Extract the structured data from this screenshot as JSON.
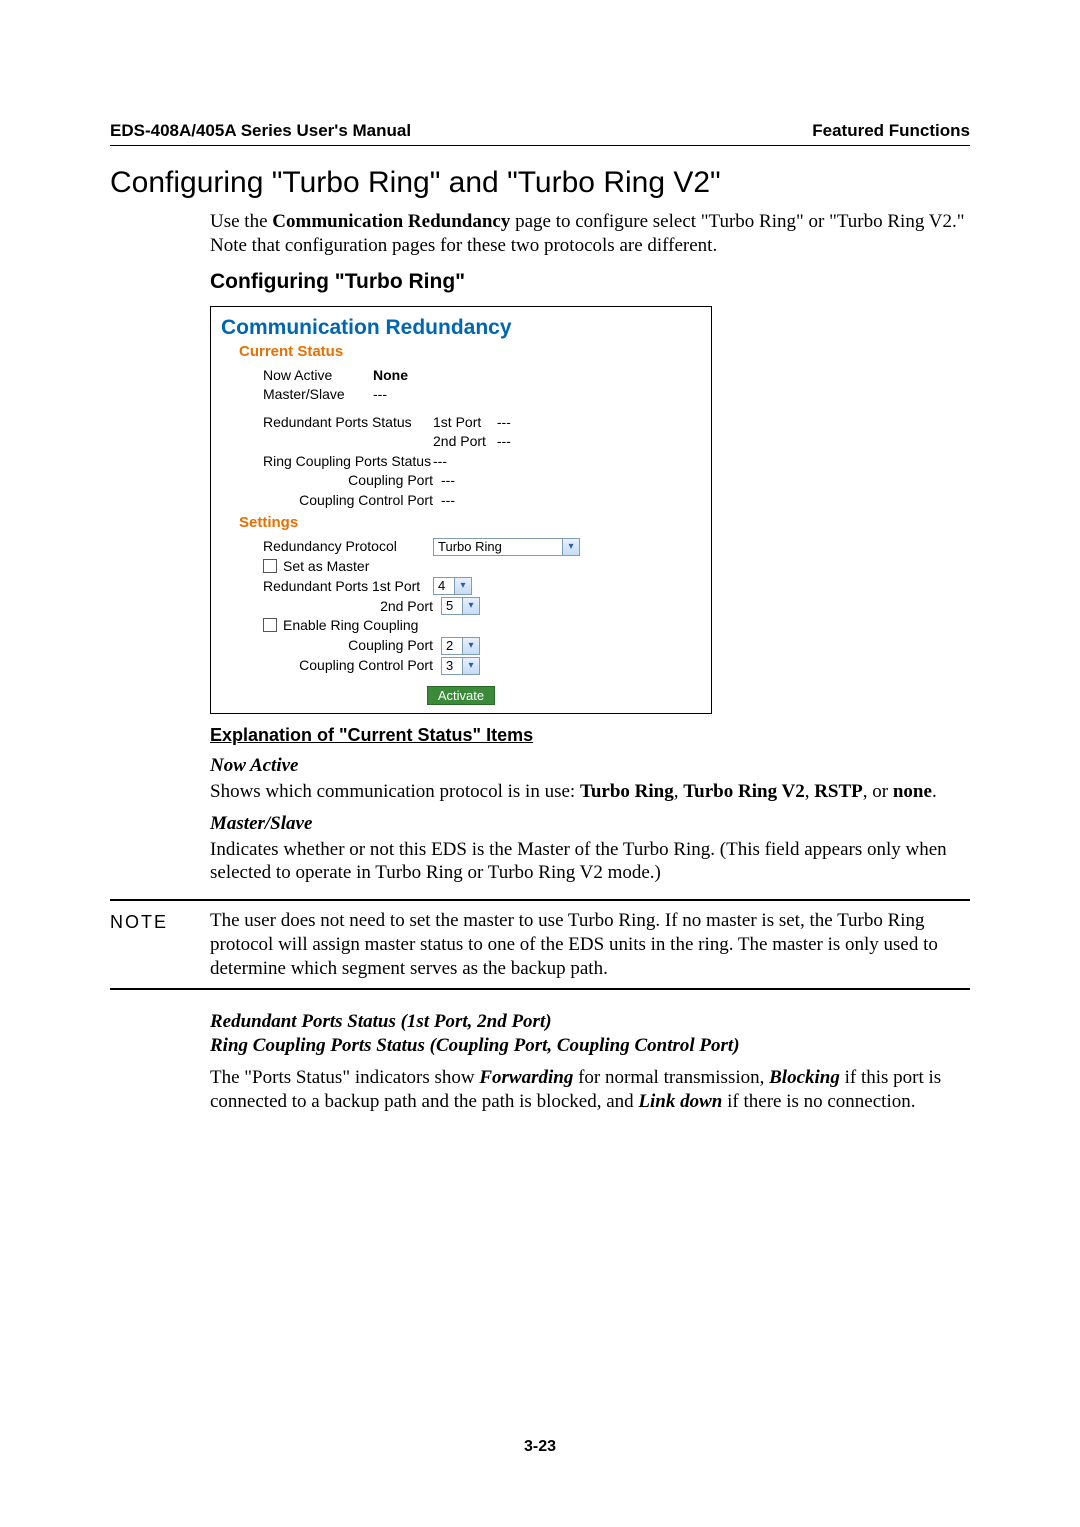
{
  "header": {
    "left": "EDS-408A/405A Series User's Manual",
    "right": "Featured Functions"
  },
  "section_title": "Configuring \"Turbo Ring\" and \"Turbo Ring V2\"",
  "intro_pre": "Use the ",
  "intro_bold": "Communication Redundancy",
  "intro_post": " page to configure select \"Turbo Ring\" or \"Turbo Ring V2.\" Note that configuration pages for these two protocols are different.",
  "sub_title": "Configuring \"Turbo Ring\"",
  "screenshot": {
    "title": "Communication Redundancy",
    "section_current": "Current Status",
    "now_active_label": "Now Active",
    "now_active_value": "None",
    "master_slave_label": "Master/Slave",
    "master_slave_value": "---",
    "red_ports_label": "Redundant Ports Status",
    "port1_label": "1st Port",
    "port1_value": "---",
    "port2_label": "2nd Port",
    "port2_value": "---",
    "ring_coupling_label": "Ring Coupling Ports Status",
    "ring_coupling_value": "---",
    "coupling_port_label": "Coupling Port",
    "coupling_port_value": "---",
    "coupling_ctrl_label": "Coupling Control Port",
    "coupling_ctrl_value": "---",
    "section_settings": "Settings",
    "redund_proto_label": "Redundancy Protocol",
    "redund_proto_value": "Turbo Ring",
    "set_master_label": "Set as Master",
    "redund_ports_1_label": "Redundant Ports 1st Port",
    "redund_ports_1_value": "4",
    "redund_ports_2_label": "2nd Port",
    "redund_ports_2_value": "5",
    "enable_ring_label": "Enable Ring Coupling",
    "s_coupling_port_label": "Coupling Port",
    "s_coupling_port_value": "2",
    "s_coupling_ctrl_label": "Coupling Control Port",
    "s_coupling_ctrl_value": "3",
    "activate": "Activate"
  },
  "explain": {
    "heading": "Explanation of \"Current Status\" Items",
    "now_active_title": "Now Active",
    "now_active_pre": "Shows which communication protocol is in use: ",
    "now_active_b1": "Turbo Ring",
    "now_active_b2": "Turbo Ring V2",
    "now_active_b3": "RSTP",
    "now_active_b4": "none",
    "master_slave_title": "Master/Slave",
    "master_slave_text": "Indicates whether or not this EDS is the Master of the Turbo Ring. (This field appears only when selected to operate in Turbo Ring or Turbo Ring V2 mode.)"
  },
  "note": {
    "label": "NOTE",
    "text": "The user does not need to set the master to use Turbo Ring. If no master is set, the Turbo Ring protocol will assign master status to one of the EDS units in the ring. The master is only used to determine which segment serves as the backup path."
  },
  "after_note": {
    "line1": "Redundant Ports Status (1st Port, 2nd Port)",
    "line2": "Ring Coupling Ports Status (Coupling Port, Coupling Control Port)",
    "para_pre": "The \"Ports Status\" indicators show ",
    "w1": "Forwarding",
    "mid1": " for normal transmission, ",
    "w2": "Blocking",
    "mid2": " if this port is connected to a backup path and the path is blocked, and ",
    "w3": "Link down",
    "mid3": " if there is no connection."
  },
  "page_num": "3-23"
}
